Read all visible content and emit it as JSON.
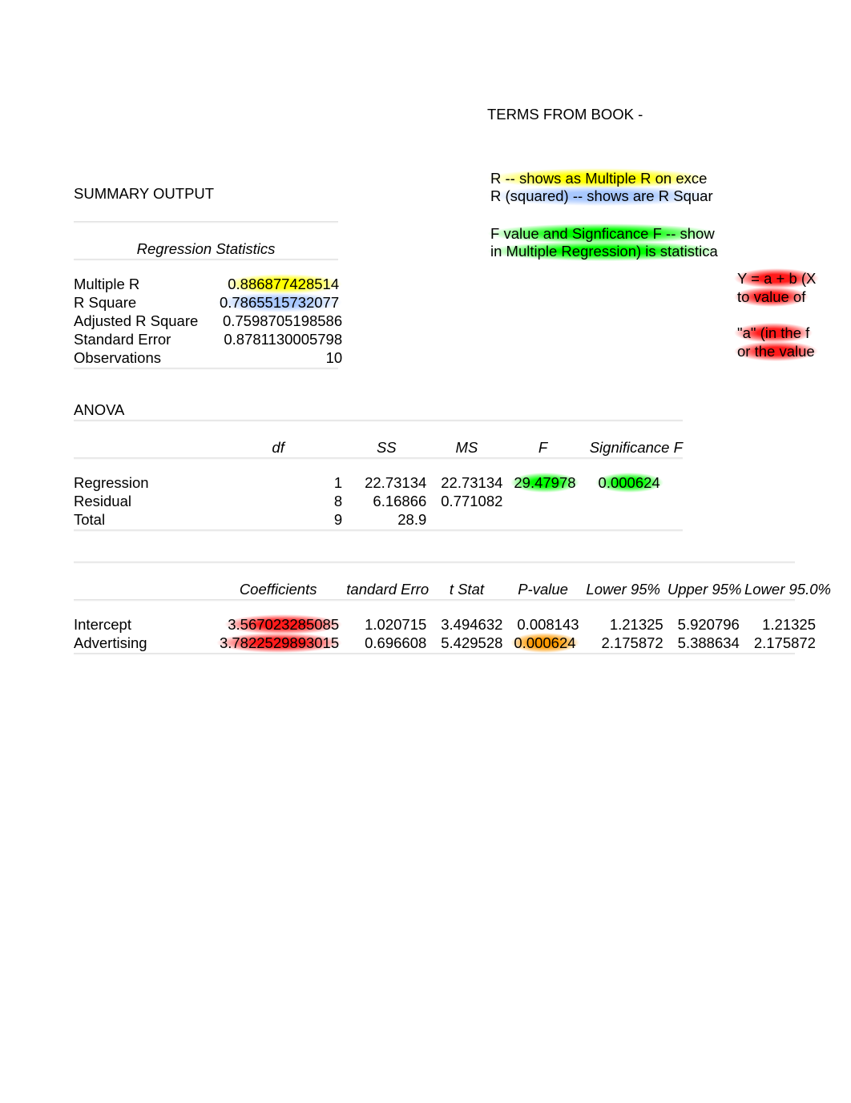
{
  "terms": {
    "title": "TERMS FROM BOOK  -",
    "rline": "R  -- shows as Multiple R on exce",
    "rsquaredline": "R (squared) -- shows are R Squar",
    "fline": "F value and Signficance F --  show",
    "fline2": "in Multiple Regression) is statistica"
  },
  "right_notes": {
    "yab": "Y = a + b (X",
    "toval": "to value of",
    "ainthef": "\"a\" (in the f",
    "orval": "or the value"
  },
  "summary": {
    "title": "SUMMARY OUTPUT",
    "reg_stats_header": "Regression Statistics",
    "rows": {
      "multiple_r": {
        "label": "Multiple R",
        "value": "0.886877428514"
      },
      "r_square": {
        "label": "R Square",
        "value": "0.7865515732077"
      },
      "adj_r_square": {
        "label": "Adjusted R Square",
        "value": "0.7598705198586"
      },
      "std_error": {
        "label": "Standard Error",
        "value": "0.8781130005798"
      },
      "observations": {
        "label": "Observations",
        "value": "10"
      }
    }
  },
  "anova": {
    "title": "ANOVA",
    "headers": {
      "df": "df",
      "ss": "SS",
      "ms": "MS",
      "f": "F",
      "sigf": "Significance F"
    },
    "regression": {
      "label": "Regression",
      "df": "1",
      "ss": "22.73134",
      "ms": "22.73134",
      "f": "29.47978",
      "sigf": "0.000624"
    },
    "residual": {
      "label": "Residual",
      "df": "8",
      "ss": "6.16866",
      "ms": "0.771082"
    },
    "total": {
      "label": "Total",
      "df": "9",
      "ss": "28.9"
    }
  },
  "coef": {
    "headers": {
      "coef": "Coefficients",
      "se": "tandard Erro",
      "tstat": "t Stat",
      "pval": "P-value",
      "l95": "Lower 95%",
      "u95": "Upper 95%",
      "l950": "Lower 95.0%"
    },
    "intercept": {
      "label": "Intercept",
      "coef": "3.567023285085",
      "se": "1.020715",
      "tstat": "3.494632",
      "pval": "0.008143",
      "l95": "1.21325",
      "u95": "5.920796",
      "l950": "1.21325"
    },
    "advertising": {
      "label": "Advertising",
      "coef": "3.7822529893015",
      "se": "0.696608",
      "tstat": "5.429528",
      "pval": "0.000624",
      "l95": "2.175872",
      "u95": "5.388634",
      "l950": "2.175872"
    }
  }
}
